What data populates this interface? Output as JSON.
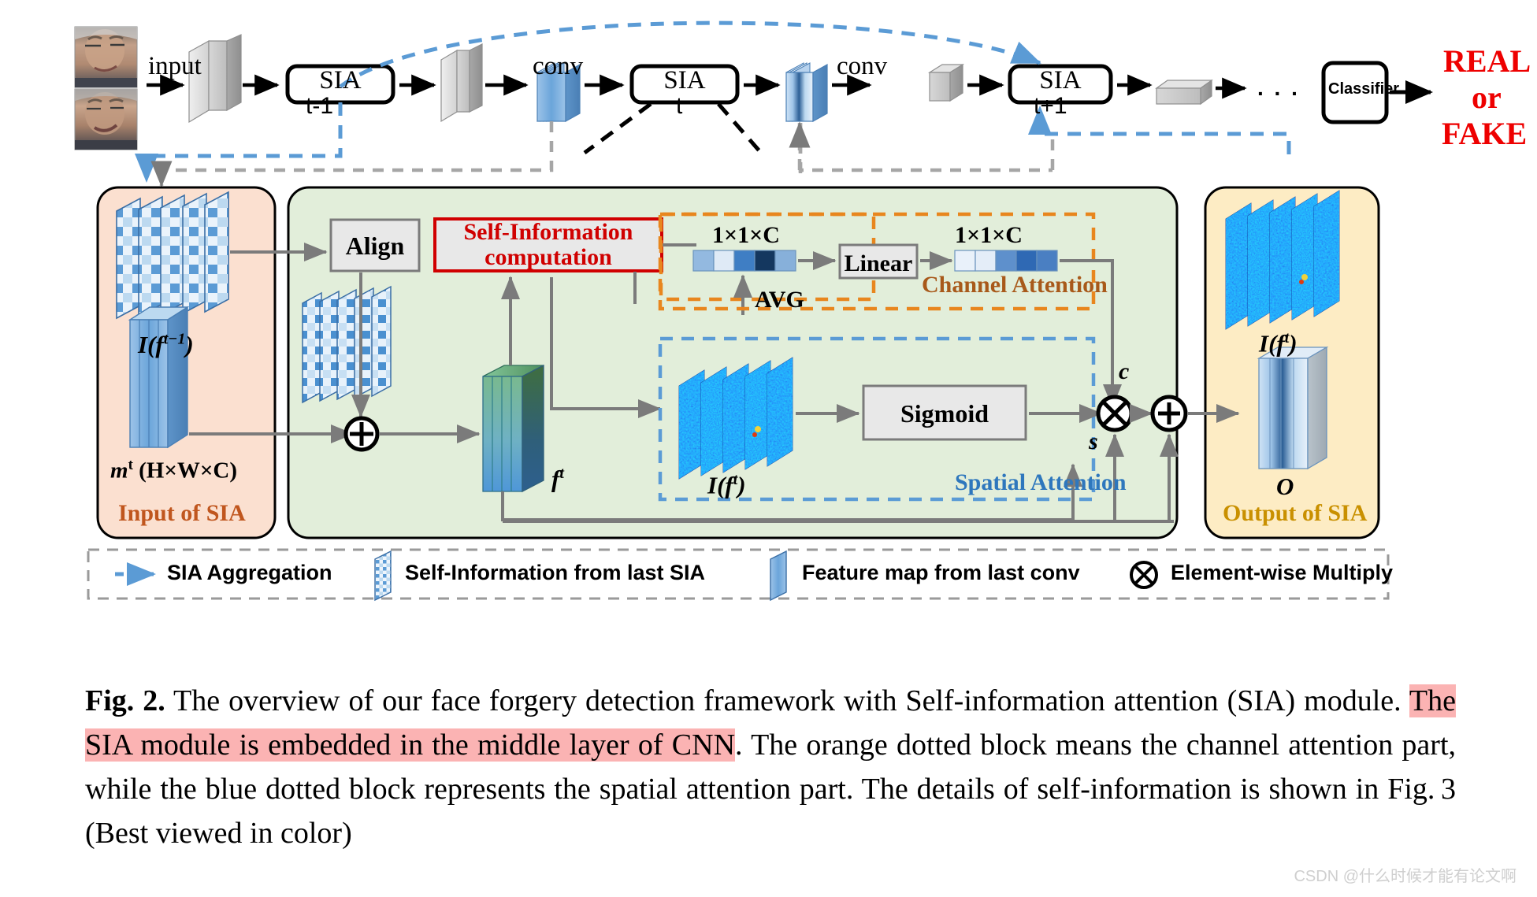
{
  "figure": {
    "id": "Fig. 2.",
    "pipeline": {
      "input_label": "input",
      "conv_label_1": "conv",
      "conv_label_2": "conv",
      "sia_label": "SIA",
      "step_prev": "t-1",
      "step_cur": "t",
      "step_next": "t+1",
      "ellipsis": ". . .",
      "classifier_label": "Classifier",
      "verdict_line1": "REAL",
      "verdict_line2": "or",
      "verdict_line3": "FAKE",
      "verdict_color": "#ff0000"
    },
    "input_panel": {
      "title": "Input of SIA",
      "self_info_label": "I(f t−1)",
      "feature_label": "m t (H×W×C)",
      "fill": "#fbe0d0",
      "title_color": "#c0561e"
    },
    "sia_panel": {
      "fill": "#e2eeda",
      "align_label": "Align",
      "self_info_box": "Self-Information computation",
      "self_info_box_color": "#d00000",
      "fused_feature_label": "f t",
      "add_symbol": "⊕",
      "multiply_symbol": "⊗",
      "channel_gate_label": "c",
      "spatial_gate_label": "s"
    },
    "channel_attention": {
      "title": "Channel Attention",
      "color": "#e8861e",
      "input_vector_label": "1×1×C",
      "output_vector_label": "1×1×C",
      "avg_label": "AVG",
      "linear_label": "Linear"
    },
    "spatial_attention": {
      "title": "Spatial Attention",
      "color": "#3a83c9",
      "self_info_label": "I(f t)",
      "sigmoid_label": "Sigmoid"
    },
    "output_panel": {
      "title": "Output of SIA",
      "self_info_label": "I(f t)",
      "output_label": "O",
      "fill": "#fdecc4",
      "title_color": "#c99000"
    },
    "legend": [
      {
        "name": "sia-aggregation",
        "icon": "dashed-blue-arrow",
        "label": "SIA Aggregation"
      },
      {
        "name": "self-information-last-sia",
        "icon": "checker-plane",
        "label": "Self-Information from last SIA"
      },
      {
        "name": "feature-map-last-conv",
        "icon": "blue-plane",
        "label": "Feature map from last conv"
      },
      {
        "name": "element-wise-multiply",
        "icon": "circle-times",
        "label": "Element-wise Multiply"
      }
    ],
    "caption": {
      "bold_prefix": "Fig. 2.",
      "part1": " The overview of our face forgery detection framework with Self-information attention (SIA) module. ",
      "highlight": "The SIA module is embedded in the middle layer of CNN",
      "part2": ". The orange dotted block means the channel attention part, while the blue dotted block represents the spatial attention part. The details of self-information is shown in Fig. 3 (Best viewed in color)",
      "highlight_color": "#fbb3b3"
    },
    "watermark": "CSDN @什么时候才能有论文啊"
  }
}
